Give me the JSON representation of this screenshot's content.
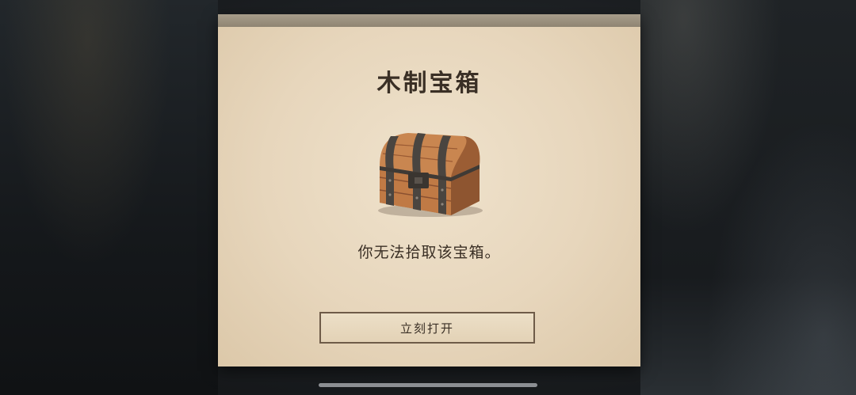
{
  "dialog": {
    "title": "木制宝箱",
    "message": "你无法拾取该宝箱。",
    "button_label": "立刻打开",
    "item_icon": "wooden-chest-icon"
  },
  "colors": {
    "paper": "#e7d6bc",
    "text": "#3a2f25",
    "button_border": "#6e5b48",
    "topbar": "#9c917f"
  }
}
